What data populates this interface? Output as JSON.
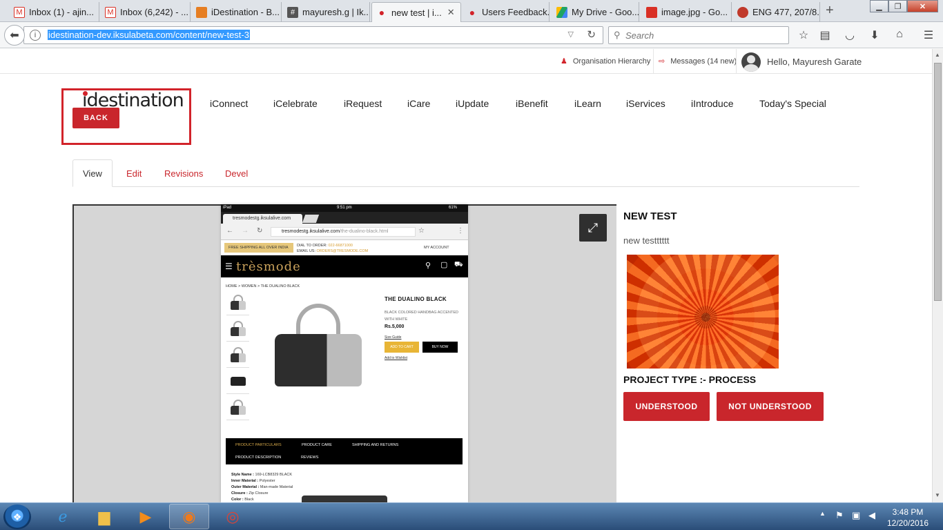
{
  "browser": {
    "tabs": [
      {
        "label": "Inbox (1) - ajin...",
        "icon": "gmail-icon",
        "color": "#d93025"
      },
      {
        "label": "Inbox (6,242) - ...",
        "icon": "gmail-icon",
        "color": "#d93025"
      },
      {
        "label": "iDestination - B...",
        "icon": "idestination-icon",
        "color": "#e67e22"
      },
      {
        "label": "mayuresh.g | Ik...",
        "icon": "slack-icon",
        "color": "#555"
      },
      {
        "label": "new test | i...",
        "icon": "location-pin-icon",
        "color": "#d2232a",
        "active": true
      },
      {
        "label": "Users Feedback...",
        "icon": "location-pin-icon",
        "color": "#d2232a"
      },
      {
        "label": "My Drive - Goo...",
        "icon": "google-drive-icon",
        "color": "#1fa463"
      },
      {
        "label": "image.jpg - Go...",
        "icon": "image-icon",
        "color": "#d93025"
      },
      {
        "label": "ENG 477, 207/8...",
        "icon": "site-icon",
        "color": "#c0392b"
      }
    ],
    "url": "idestination-dev.iksulabeta.com/content/new-test-3",
    "search_placeholder": "Search"
  },
  "topstrip": {
    "org_hierarchy": "Organisation Hierarchy",
    "messages": "Messages (14 new)",
    "greeting": "Hello, Mayuresh Garate"
  },
  "logo": {
    "text": "idestination",
    "back": "BACK"
  },
  "mainnav": [
    "iConnect",
    "iCelebrate",
    "iRequest",
    "iCare",
    "iUpdate",
    "iBenefit",
    "iLearn",
    "iServices",
    "iIntroduce",
    "Today's Special"
  ],
  "page_tabs": [
    "View",
    "Edit",
    "Revisions",
    "Devel"
  ],
  "screenshot": {
    "status_left": "iPad",
    "status_time": "9:51 pm",
    "status_battery": "61%",
    "tab_label": "tresmodestg.iksulalive.com",
    "url_domain": "tresmodestg.iksulalive.com",
    "url_path": "/the-dualino-black.html",
    "promo": "FREE SHIPPING ALL OVER INDIA",
    "dial": "DIAL TO ORDER:",
    "dial_number": "022-66871000",
    "email": "EMAIL US:",
    "email_value": "ORDERS@TRESMODE.COM",
    "account": "MY ACCOUNT",
    "brand": "trèsmode",
    "breadcrumb": "HOME  >  WOMEN  >  THE DUALINO BLACK",
    "product_title": "THE DUALINO BLACK",
    "product_desc": "BLACK COLORED HANDBAG ACCENTED WITH WHITE",
    "price": "Rs.5,000",
    "size_guide": "Size Guide",
    "add_to_cart": "ADD TO CART",
    "buy_now": "BUY NOW",
    "wishlist": "Add to Wishlist",
    "menu": [
      "PRODUCT PARTICULARS",
      "PRODUCT CARE",
      "SHIPPING AND RETURNS",
      "PRODUCT DESCRIPTION",
      "REVIEWS"
    ],
    "specs": [
      {
        "k": "Style Name :",
        "v": "169-LCB8329 BLACK"
      },
      {
        "k": "Inner Material :",
        "v": "Polyester"
      },
      {
        "k": "Outer Material :",
        "v": "Man-made Material"
      },
      {
        "k": "Closure :",
        "v": "Zip Closure"
      },
      {
        "k": "Color :",
        "v": "Black"
      }
    ]
  },
  "content": {
    "title": "NEW TEST",
    "body": "new testttttt",
    "project_type": "PROJECT TYPE :- PROCESS",
    "understood": "UNDERSTOOD",
    "not_understood": "NOT UNDERSTOOD"
  },
  "taskbar": {
    "time": "3:48 PM",
    "date": "12/20/2016"
  },
  "colors": {
    "brand_red": "#c9262c",
    "logo_box": "#d2232a"
  }
}
